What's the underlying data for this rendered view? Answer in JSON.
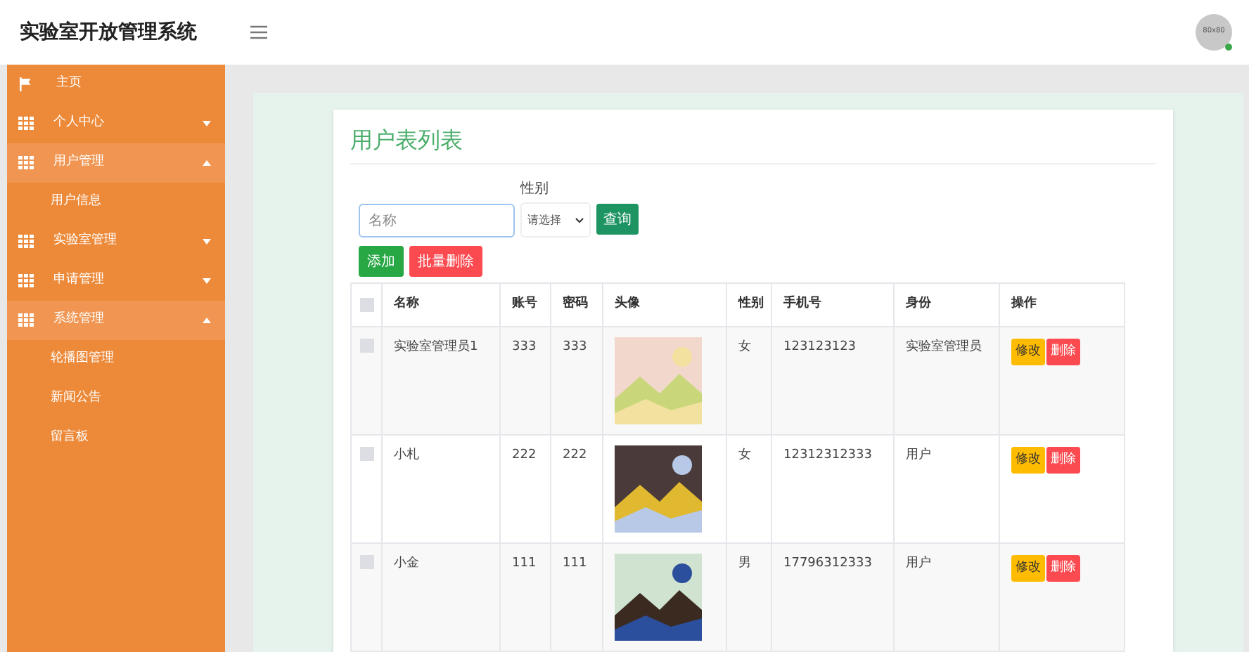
{
  "header": {
    "title": "实验室开放管理系统",
    "avatar_text": "80x80"
  },
  "sidebar": {
    "items": [
      {
        "kind": "link",
        "label": "主页"
      },
      {
        "kind": "menu",
        "label": "个人中心",
        "expanded": false
      },
      {
        "kind": "menu",
        "label": "用户管理",
        "expanded": true,
        "children": [
          {
            "label": "用户信息"
          }
        ]
      },
      {
        "kind": "menu",
        "label": "实验室管理",
        "expanded": false
      },
      {
        "kind": "menu",
        "label": "申请管理",
        "expanded": false
      },
      {
        "kind": "menu",
        "label": "系统管理",
        "expanded": true,
        "children": [
          {
            "label": "轮播图管理"
          },
          {
            "label": "新闻公告"
          },
          {
            "label": "留言板"
          }
        ]
      }
    ]
  },
  "page": {
    "title": "用户表列表",
    "search": {
      "placeholder": "名称",
      "gender_label": "性别",
      "gender_select": "请选择",
      "query_button": "查询"
    },
    "buttons": {
      "add": "添加",
      "batch_delete": "批量删除"
    },
    "table": {
      "select_all_checked": false,
      "columns": [
        "名称",
        "账号",
        "密码",
        "头像",
        "性别",
        "手机号",
        "身份",
        "操作"
      ],
      "rows": [
        {
          "checked": false,
          "name": "实验室管理员1",
          "account": "333",
          "password": "333",
          "gender": "女",
          "phone": "123123123",
          "role": "实验室管理员",
          "edit": "修改",
          "delete": "删除"
        },
        {
          "checked": false,
          "name": "小札",
          "account": "222",
          "password": "222",
          "gender": "女",
          "phone": "12312312333",
          "role": "用户",
          "edit": "修改",
          "delete": "删除"
        },
        {
          "checked": false,
          "name": "小金",
          "account": "111",
          "password": "111",
          "gender": "男",
          "phone": "17796312333",
          "role": "用户",
          "edit": "修改",
          "delete": "删除"
        }
      ]
    }
  }
}
